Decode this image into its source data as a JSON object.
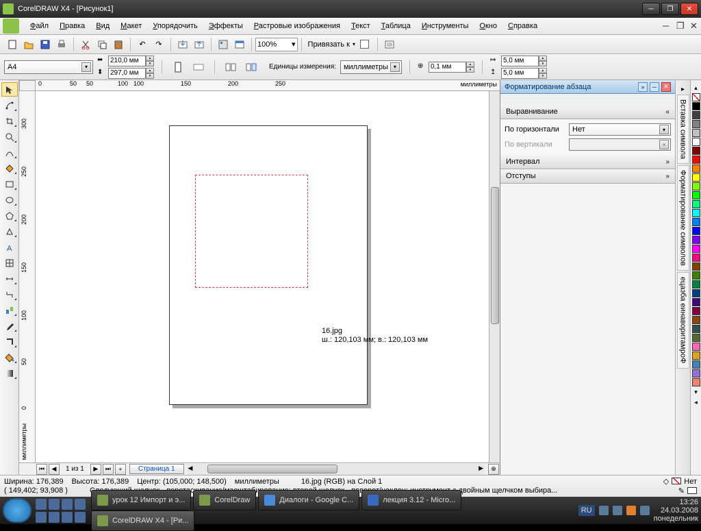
{
  "title": "CorelDRAW X4 - [Рисунок1]",
  "menus": [
    "Файл",
    "Правка",
    "Вид",
    "Макет",
    "Упорядочить",
    "Эффекты",
    "Растровые изображения",
    "Текст",
    "Таблица",
    "Инструменты",
    "Окно",
    "Справка"
  ],
  "toolbar": {
    "zoom": "100%",
    "snap_label": "Привязать к"
  },
  "properties": {
    "paper": "A4",
    "width": "210,0 мм",
    "height": "297,0 мм",
    "units_label": "Единицы измерения:",
    "units": "миллиметры",
    "nudge": "0,1 мм",
    "dup_x": "5,0 мм",
    "dup_y": "5,0 мм"
  },
  "ruler": {
    "h_ticks": [
      "0",
      "50",
      "100",
      "150",
      "200",
      "250"
    ],
    "h_unit": "миллиметры",
    "v_ticks": [
      "0",
      "50",
      "100",
      "150",
      "200",
      "250",
      "300"
    ],
    "v_unit": "миллиметры"
  },
  "import": {
    "filename": "16.jpg",
    "dims": "ш.: 120,103 мм; в.: 120,103 мм"
  },
  "page_nav": {
    "counter": "1 из 1",
    "tab": "Страница 1"
  },
  "docker": {
    "title": "Форматирование абзаца",
    "sections": {
      "align": {
        "title": "Выравнивание",
        "horiz": "По горизонтали",
        "vert": "По вертикали",
        "value": "Нет"
      },
      "spacing": "Интервал",
      "indents": "Отступы"
    },
    "tabs": [
      "Вставка символа",
      "Форматирование символов",
      "ецазба еинаворитамроФ"
    ]
  },
  "status": {
    "line1_width": "Ширина: 176,389",
    "line1_height": "Высота: 176,389",
    "line1_center": "Центр: (105,000; 148,500)",
    "line1_units": "миллиметры",
    "line1_obj": "16.jpg (RGB) на Слой 1",
    "line2_coords": "( 149,402; 93,908 )",
    "line2_hint": "Следующий щелчок - перетаскивание/масштабирование; второй щелчок - поворот/наклон; инструмент с двойным щелчком выбира...",
    "fill_none": "Нет"
  },
  "taskbar": {
    "tasks": [
      {
        "label": "урок 12 Импорт и э...",
        "icon": "#7a9a4a"
      },
      {
        "label": "CorelDraw",
        "icon": "#7a9a4a"
      },
      {
        "label": "Диалоги - Google C...",
        "icon": "#4a8ada"
      },
      {
        "label": "лекция 3.12 - Micro...",
        "icon": "#3a6ac0"
      },
      {
        "label": "CorelDRAW X4 - [Ри...",
        "icon": "#7a9a4a",
        "active": true
      }
    ],
    "lang": "RU",
    "time": "13:26",
    "date": "24.03.2008",
    "day": "понедельник"
  },
  "colors": [
    "#000000",
    "#404040",
    "#808080",
    "#C0C0C0",
    "#FFFFFF",
    "#800000",
    "#FF0000",
    "#FF8000",
    "#FFFF00",
    "#80FF00",
    "#00FF00",
    "#00FF80",
    "#00FFFF",
    "#0080FF",
    "#0000FF",
    "#8000FF",
    "#FF00FF",
    "#FF0080",
    "#804000",
    "#408000",
    "#008040",
    "#004080",
    "#400080",
    "#800040",
    "#8B4513",
    "#2F4F4F",
    "#556B2F",
    "#FF69B4",
    "#DAA520",
    "#4682B4",
    "#9370DB",
    "#FA8072"
  ]
}
